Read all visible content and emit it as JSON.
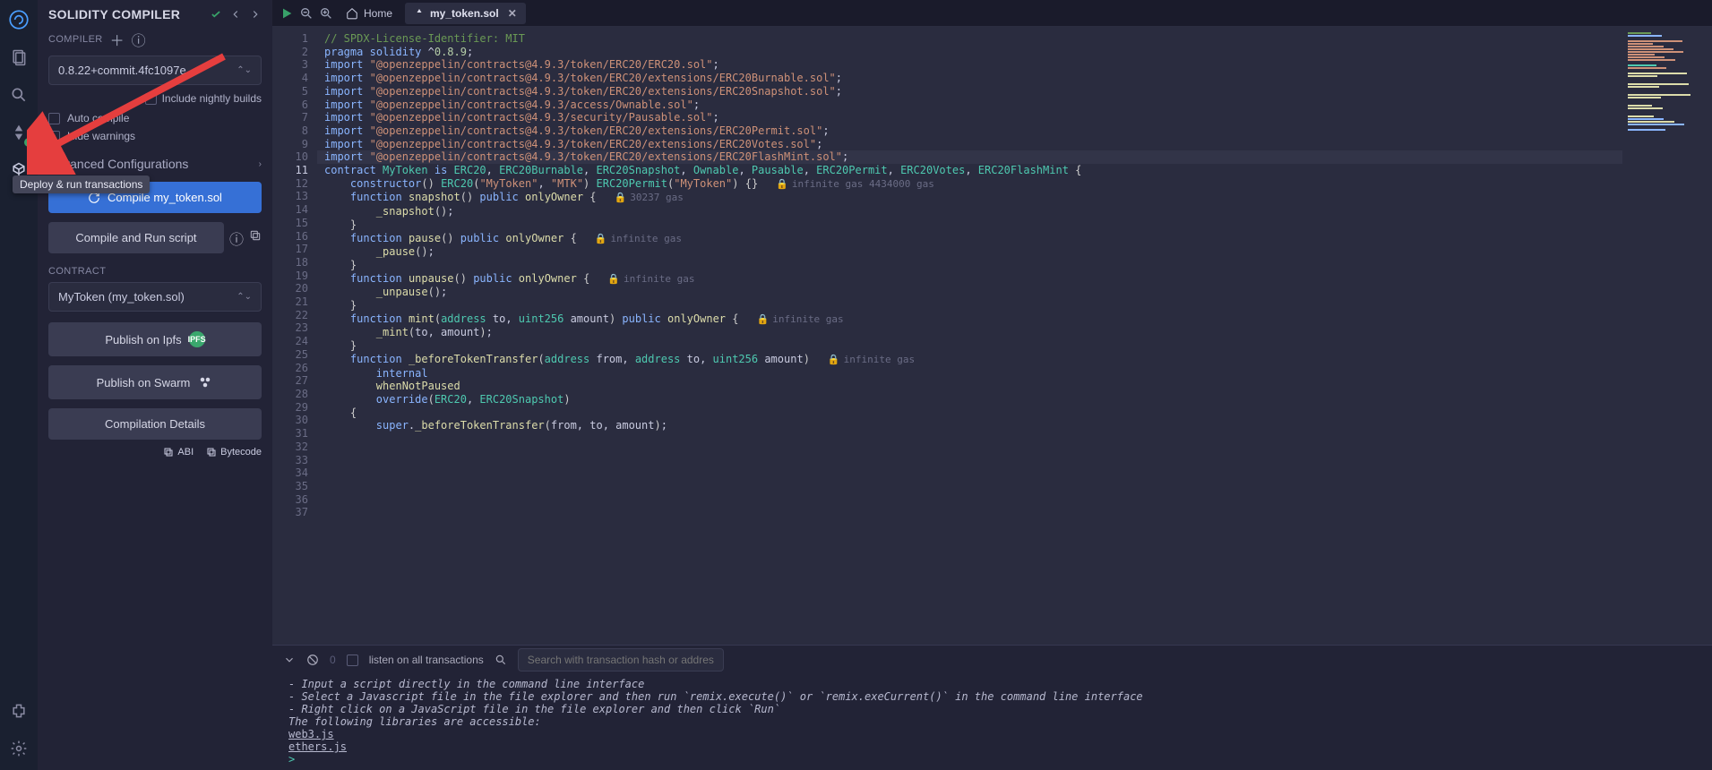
{
  "iconbar": {
    "tooltip": "Deploy & run transactions"
  },
  "sidebar": {
    "title": "SOLIDITY COMPILER",
    "compiler_label": "COMPILER",
    "compiler_version": "0.8.22+commit.4fc1097e",
    "nightly_label": "Include nightly builds",
    "auto_compile_label": "Auto compile",
    "hide_warnings_label": "Hide warnings",
    "advanced_label": "Advanced Configurations",
    "compile_btn": "Compile my_token.sol",
    "compile_run_btn": "Compile and Run script",
    "contract_label": "CONTRACT",
    "contract_selected": "MyToken (my_token.sol)",
    "publish_ipfs": "Publish on Ipfs",
    "ipfs_badge": "IPFS",
    "publish_swarm": "Publish on Swarm",
    "compilation_details": "Compilation Details",
    "abi": "ABI",
    "bytecode": "Bytecode"
  },
  "tabs": {
    "home": "Home",
    "file": "my_token.sol"
  },
  "code": {
    "lines": [
      {
        "n": 1,
        "t": [
          {
            "c": "cmt",
            "s": "// SPDX-License-Identifier: MIT"
          }
        ]
      },
      {
        "n": 2,
        "t": [
          {
            "c": "kw",
            "s": "pragma"
          },
          {
            "c": "",
            "s": " "
          },
          {
            "c": "kw",
            "s": "solidity"
          },
          {
            "c": "",
            "s": " ^"
          },
          {
            "c": "num",
            "s": "0.8.9"
          },
          {
            "c": "",
            "s": ";"
          }
        ]
      },
      {
        "n": 3,
        "t": []
      },
      {
        "n": 4,
        "t": [
          {
            "c": "kw",
            "s": "import"
          },
          {
            "c": "",
            "s": " "
          },
          {
            "c": "str",
            "s": "\"@openzeppelin/contracts@4.9.3/token/ERC20/ERC20.sol\""
          },
          {
            "c": "",
            "s": ";"
          }
        ]
      },
      {
        "n": 5,
        "t": [
          {
            "c": "kw",
            "s": "import"
          },
          {
            "c": "",
            "s": " "
          },
          {
            "c": "str",
            "s": "\"@openzeppelin/contracts@4.9.3/token/ERC20/extensions/ERC20Burnable.sol\""
          },
          {
            "c": "",
            "s": ";"
          }
        ]
      },
      {
        "n": 6,
        "t": [
          {
            "c": "kw",
            "s": "import"
          },
          {
            "c": "",
            "s": " "
          },
          {
            "c": "str",
            "s": "\"@openzeppelin/contracts@4.9.3/token/ERC20/extensions/ERC20Snapshot.sol\""
          },
          {
            "c": "",
            "s": ";"
          }
        ]
      },
      {
        "n": 7,
        "t": [
          {
            "c": "kw",
            "s": "import"
          },
          {
            "c": "",
            "s": " "
          },
          {
            "c": "str",
            "s": "\"@openzeppelin/contracts@4.9.3/access/Ownable.sol\""
          },
          {
            "c": "",
            "s": ";"
          }
        ]
      },
      {
        "n": 8,
        "t": [
          {
            "c": "kw",
            "s": "import"
          },
          {
            "c": "",
            "s": " "
          },
          {
            "c": "str",
            "s": "\"@openzeppelin/contracts@4.9.3/security/Pausable.sol\""
          },
          {
            "c": "",
            "s": ";"
          }
        ]
      },
      {
        "n": 9,
        "t": [
          {
            "c": "kw",
            "s": "import"
          },
          {
            "c": "",
            "s": " "
          },
          {
            "c": "str",
            "s": "\"@openzeppelin/contracts@4.9.3/token/ERC20/extensions/ERC20Permit.sol\""
          },
          {
            "c": "",
            "s": ";"
          }
        ]
      },
      {
        "n": 10,
        "t": [
          {
            "c": "kw",
            "s": "import"
          },
          {
            "c": "",
            "s": " "
          },
          {
            "c": "str",
            "s": "\"@openzeppelin/contracts@4.9.3/token/ERC20/extensions/ERC20Votes.sol\""
          },
          {
            "c": "",
            "s": ";"
          }
        ]
      },
      {
        "n": 11,
        "hl": true,
        "t": [
          {
            "c": "kw",
            "s": "import"
          },
          {
            "c": "",
            "s": " "
          },
          {
            "c": "str",
            "s": "\"@openzeppelin/contracts@4.9.3/token/ERC20/extensions/ERC20FlashMint.sol\""
          },
          {
            "c": "",
            "s": ";"
          }
        ]
      },
      {
        "n": 12,
        "t": []
      },
      {
        "n": 13,
        "t": [
          {
            "c": "kw",
            "s": "contract"
          },
          {
            "c": "",
            "s": " "
          },
          {
            "c": "type",
            "s": "MyToken"
          },
          {
            "c": "",
            "s": " "
          },
          {
            "c": "kw",
            "s": "is"
          },
          {
            "c": "",
            "s": " "
          },
          {
            "c": "type",
            "s": "ERC20"
          },
          {
            "c": "",
            "s": ", "
          },
          {
            "c": "type",
            "s": "ERC20Burnable"
          },
          {
            "c": "",
            "s": ", "
          },
          {
            "c": "type",
            "s": "ERC20Snapshot"
          },
          {
            "c": "",
            "s": ", "
          },
          {
            "c": "type",
            "s": "Ownable"
          },
          {
            "c": "",
            "s": ", "
          },
          {
            "c": "type",
            "s": "Pausable"
          },
          {
            "c": "",
            "s": ", "
          },
          {
            "c": "type",
            "s": "ERC20Permit"
          },
          {
            "c": "",
            "s": ", "
          },
          {
            "c": "type",
            "s": "ERC20Votes"
          },
          {
            "c": "",
            "s": ", "
          },
          {
            "c": "type",
            "s": "ERC20FlashMint"
          },
          {
            "c": "",
            "s": " "
          },
          {
            "c": "bl",
            "s": "{"
          }
        ]
      },
      {
        "n": 14,
        "gas": "infinite gas 4434000 gas",
        "t": [
          {
            "c": "",
            "s": "    "
          },
          {
            "c": "kw",
            "s": "constructor"
          },
          {
            "c": "bl",
            "s": "()"
          },
          {
            "c": "",
            "s": " "
          },
          {
            "c": "type",
            "s": "ERC20"
          },
          {
            "c": "bl",
            "s": "("
          },
          {
            "c": "str",
            "s": "\"MyToken\""
          },
          {
            "c": "",
            "s": ", "
          },
          {
            "c": "str",
            "s": "\"MTK\""
          },
          {
            "c": "bl",
            "s": ")"
          },
          {
            "c": "",
            "s": " "
          },
          {
            "c": "type",
            "s": "ERC20Permit"
          },
          {
            "c": "bl",
            "s": "("
          },
          {
            "c": "str",
            "s": "\"MyToken\""
          },
          {
            "c": "bl",
            "s": ")"
          },
          {
            "c": "",
            "s": " "
          },
          {
            "c": "bl",
            "s": "{}"
          }
        ]
      },
      {
        "n": 15,
        "t": []
      },
      {
        "n": 16,
        "gas": "30237 gas",
        "t": [
          {
            "c": "",
            "s": "    "
          },
          {
            "c": "kw",
            "s": "function"
          },
          {
            "c": "",
            "s": " "
          },
          {
            "c": "fn",
            "s": "snapshot"
          },
          {
            "c": "bl",
            "s": "()"
          },
          {
            "c": "",
            "s": " "
          },
          {
            "c": "kw",
            "s": "public"
          },
          {
            "c": "",
            "s": " "
          },
          {
            "c": "fn",
            "s": "onlyOwner"
          },
          {
            "c": "",
            "s": " "
          },
          {
            "c": "bl",
            "s": "{"
          }
        ]
      },
      {
        "n": 17,
        "t": [
          {
            "c": "",
            "s": "        "
          },
          {
            "c": "fn",
            "s": "_snapshot"
          },
          {
            "c": "bl",
            "s": "()"
          },
          {
            "c": "",
            "s": ";"
          }
        ]
      },
      {
        "n": 18,
        "t": [
          {
            "c": "",
            "s": "    "
          },
          {
            "c": "bl",
            "s": "}"
          }
        ]
      },
      {
        "n": 19,
        "t": []
      },
      {
        "n": 20,
        "gas": "infinite gas",
        "t": [
          {
            "c": "",
            "s": "    "
          },
          {
            "c": "kw",
            "s": "function"
          },
          {
            "c": "",
            "s": " "
          },
          {
            "c": "fn",
            "s": "pause"
          },
          {
            "c": "bl",
            "s": "()"
          },
          {
            "c": "",
            "s": " "
          },
          {
            "c": "kw",
            "s": "public"
          },
          {
            "c": "",
            "s": " "
          },
          {
            "c": "fn",
            "s": "onlyOwner"
          },
          {
            "c": "",
            "s": " "
          },
          {
            "c": "bl",
            "s": "{"
          }
        ]
      },
      {
        "n": 21,
        "t": [
          {
            "c": "",
            "s": "        "
          },
          {
            "c": "fn",
            "s": "_pause"
          },
          {
            "c": "bl",
            "s": "()"
          },
          {
            "c": "",
            "s": ";"
          }
        ]
      },
      {
        "n": 22,
        "t": [
          {
            "c": "",
            "s": "    "
          },
          {
            "c": "bl",
            "s": "}"
          }
        ]
      },
      {
        "n": 23,
        "t": []
      },
      {
        "n": 24,
        "gas": "infinite gas",
        "t": [
          {
            "c": "",
            "s": "    "
          },
          {
            "c": "kw",
            "s": "function"
          },
          {
            "c": "",
            "s": " "
          },
          {
            "c": "fn",
            "s": "unpause"
          },
          {
            "c": "bl",
            "s": "()"
          },
          {
            "c": "",
            "s": " "
          },
          {
            "c": "kw",
            "s": "public"
          },
          {
            "c": "",
            "s": " "
          },
          {
            "c": "fn",
            "s": "onlyOwner"
          },
          {
            "c": "",
            "s": " "
          },
          {
            "c": "bl",
            "s": "{"
          }
        ]
      },
      {
        "n": 25,
        "t": [
          {
            "c": "",
            "s": "        "
          },
          {
            "c": "fn",
            "s": "_unpause"
          },
          {
            "c": "bl",
            "s": "()"
          },
          {
            "c": "",
            "s": ";"
          }
        ]
      },
      {
        "n": 26,
        "t": [
          {
            "c": "",
            "s": "    "
          },
          {
            "c": "bl",
            "s": "}"
          }
        ]
      },
      {
        "n": 27,
        "t": []
      },
      {
        "n": 28,
        "gas": "infinite gas",
        "t": [
          {
            "c": "",
            "s": "    "
          },
          {
            "c": "kw",
            "s": "function"
          },
          {
            "c": "",
            "s": " "
          },
          {
            "c": "fn",
            "s": "mint"
          },
          {
            "c": "bl",
            "s": "("
          },
          {
            "c": "type",
            "s": "address"
          },
          {
            "c": "",
            "s": " to, "
          },
          {
            "c": "type",
            "s": "uint256"
          },
          {
            "c": "",
            "s": " amount"
          },
          {
            "c": "bl",
            "s": ")"
          },
          {
            "c": "",
            "s": " "
          },
          {
            "c": "kw",
            "s": "public"
          },
          {
            "c": "",
            "s": " "
          },
          {
            "c": "fn",
            "s": "onlyOwner"
          },
          {
            "c": "",
            "s": " "
          },
          {
            "c": "bl",
            "s": "{"
          }
        ]
      },
      {
        "n": 29,
        "t": [
          {
            "c": "",
            "s": "        "
          },
          {
            "c": "fn",
            "s": "_mint"
          },
          {
            "c": "bl",
            "s": "("
          },
          {
            "c": "",
            "s": "to, amount"
          },
          {
            "c": "bl",
            "s": ")"
          },
          {
            "c": "",
            "s": ";"
          }
        ]
      },
      {
        "n": 30,
        "t": [
          {
            "c": "",
            "s": "    "
          },
          {
            "c": "bl",
            "s": "}"
          }
        ]
      },
      {
        "n": 31,
        "t": []
      },
      {
        "n": 32,
        "gas": "infinite gas",
        "t": [
          {
            "c": "",
            "s": "    "
          },
          {
            "c": "kw",
            "s": "function"
          },
          {
            "c": "",
            "s": " "
          },
          {
            "c": "fn",
            "s": "_beforeTokenTransfer"
          },
          {
            "c": "bl",
            "s": "("
          },
          {
            "c": "type",
            "s": "address"
          },
          {
            "c": "",
            "s": " from, "
          },
          {
            "c": "type",
            "s": "address"
          },
          {
            "c": "",
            "s": " to, "
          },
          {
            "c": "type",
            "s": "uint256"
          },
          {
            "c": "",
            "s": " amount"
          },
          {
            "c": "bl",
            "s": ")"
          }
        ]
      },
      {
        "n": 33,
        "t": [
          {
            "c": "",
            "s": "        "
          },
          {
            "c": "kw",
            "s": "internal"
          }
        ]
      },
      {
        "n": 34,
        "t": [
          {
            "c": "",
            "s": "        "
          },
          {
            "c": "fn",
            "s": "whenNotPaused"
          }
        ]
      },
      {
        "n": 35,
        "t": [
          {
            "c": "",
            "s": "        "
          },
          {
            "c": "kw",
            "s": "override"
          },
          {
            "c": "bl",
            "s": "("
          },
          {
            "c": "type",
            "s": "ERC20"
          },
          {
            "c": "",
            "s": ", "
          },
          {
            "c": "type",
            "s": "ERC20Snapshot"
          },
          {
            "c": "bl",
            "s": ")"
          }
        ]
      },
      {
        "n": 36,
        "t": [
          {
            "c": "",
            "s": "    "
          },
          {
            "c": "bl",
            "s": "{"
          }
        ]
      },
      {
        "n": 37,
        "t": [
          {
            "c": "",
            "s": "        "
          },
          {
            "c": "kw",
            "s": "super"
          },
          {
            "c": "",
            "s": "."
          },
          {
            "c": "fn",
            "s": "_beforeTokenTransfer"
          },
          {
            "c": "bl",
            "s": "("
          },
          {
            "c": "",
            "s": "from, to, amount"
          },
          {
            "c": "bl",
            "s": ")"
          },
          {
            "c": "",
            "s": ";"
          }
        ]
      }
    ]
  },
  "terminal": {
    "zero": "0",
    "listen_label": "listen on all transactions",
    "search_placeholder": "Search with transaction hash or address",
    "lines": [
      " - Input a script directly in the command line interface",
      " - Select a Javascript file in the file explorer and then run `remix.execute()` or `remix.exeCurrent()`  in the command line interface",
      " - Right click on a JavaScript file in the file explorer and then click `Run`",
      "",
      "The following libraries are accessible:"
    ],
    "links": [
      "web3.js",
      "ethers.js"
    ],
    "prompt": ">"
  }
}
